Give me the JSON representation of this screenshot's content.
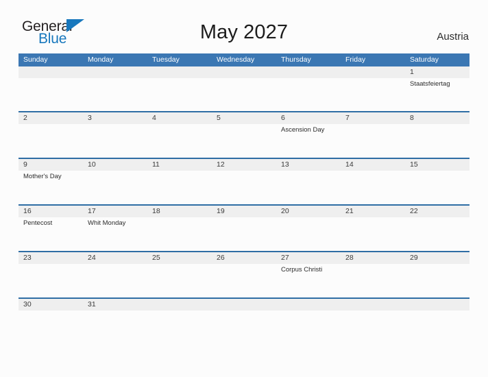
{
  "brand": {
    "name_part1": "General",
    "name_part2": "Blue",
    "accent_color": "#1878bd"
  },
  "header": {
    "title": "May 2027",
    "country": "Austria"
  },
  "calendar": {
    "month": "May",
    "year": "2027",
    "header_color": "#3b77b3",
    "row_border_color": "#2e6da4",
    "date_strip_color": "#efefef",
    "weekdays": [
      "Sunday",
      "Monday",
      "Tuesday",
      "Wednesday",
      "Thursday",
      "Friday",
      "Saturday"
    ],
    "weeks": [
      {
        "days": [
          {
            "date": "",
            "event": ""
          },
          {
            "date": "",
            "event": ""
          },
          {
            "date": "",
            "event": ""
          },
          {
            "date": "",
            "event": ""
          },
          {
            "date": "",
            "event": ""
          },
          {
            "date": "",
            "event": ""
          },
          {
            "date": "1",
            "event": "Staatsfeiertag"
          }
        ]
      },
      {
        "days": [
          {
            "date": "2",
            "event": ""
          },
          {
            "date": "3",
            "event": ""
          },
          {
            "date": "4",
            "event": ""
          },
          {
            "date": "5",
            "event": ""
          },
          {
            "date": "6",
            "event": "Ascension Day"
          },
          {
            "date": "7",
            "event": ""
          },
          {
            "date": "8",
            "event": ""
          }
        ]
      },
      {
        "days": [
          {
            "date": "9",
            "event": "Mother's Day"
          },
          {
            "date": "10",
            "event": ""
          },
          {
            "date": "11",
            "event": ""
          },
          {
            "date": "12",
            "event": ""
          },
          {
            "date": "13",
            "event": ""
          },
          {
            "date": "14",
            "event": ""
          },
          {
            "date": "15",
            "event": ""
          }
        ]
      },
      {
        "days": [
          {
            "date": "16",
            "event": "Pentecost"
          },
          {
            "date": "17",
            "event": "Whit Monday"
          },
          {
            "date": "18",
            "event": ""
          },
          {
            "date": "19",
            "event": ""
          },
          {
            "date": "20",
            "event": ""
          },
          {
            "date": "21",
            "event": ""
          },
          {
            "date": "22",
            "event": ""
          }
        ]
      },
      {
        "days": [
          {
            "date": "23",
            "event": ""
          },
          {
            "date": "24",
            "event": ""
          },
          {
            "date": "25",
            "event": ""
          },
          {
            "date": "26",
            "event": ""
          },
          {
            "date": "27",
            "event": "Corpus Christi"
          },
          {
            "date": "28",
            "event": ""
          },
          {
            "date": "29",
            "event": ""
          }
        ]
      },
      {
        "days": [
          {
            "date": "30",
            "event": ""
          },
          {
            "date": "31",
            "event": ""
          },
          {
            "date": "",
            "event": ""
          },
          {
            "date": "",
            "event": ""
          },
          {
            "date": "",
            "event": ""
          },
          {
            "date": "",
            "event": ""
          },
          {
            "date": "",
            "event": ""
          }
        ]
      }
    ]
  }
}
